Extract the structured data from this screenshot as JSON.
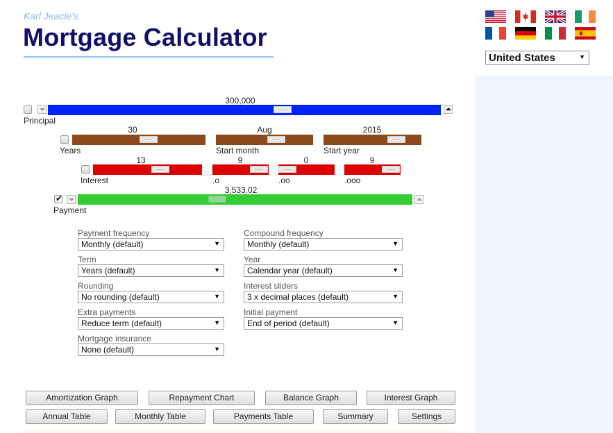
{
  "header": {
    "subtitle": "Karl Jeacle's",
    "title": "Mortgage Calculator"
  },
  "flags": [
    {
      "name": "us-flag-icon",
      "country": "United States"
    },
    {
      "name": "canada-flag-icon",
      "country": "Canada"
    },
    {
      "name": "uk-flag-icon",
      "country": "United Kingdom"
    },
    {
      "name": "ireland-flag-icon",
      "country": "Ireland"
    },
    {
      "name": "france-flag-icon",
      "country": "France"
    },
    {
      "name": "germany-flag-icon",
      "country": "Germany"
    },
    {
      "name": "italy-flag-icon",
      "country": "Italy"
    },
    {
      "name": "spain-flag-icon",
      "country": "Spain"
    }
  ],
  "country_select": {
    "value": "United States"
  },
  "sliders": {
    "principal": {
      "label": "Principal",
      "value": "300,000",
      "color": "#0022ff",
      "checked": false
    },
    "years": {
      "label": "Years",
      "value": "30",
      "color": "#8b4a1b"
    },
    "start_month": {
      "label": "Start month",
      "value": "Aug",
      "color": "#8b4a1b"
    },
    "start_year": {
      "label": "Start year",
      "value": "2015",
      "color": "#8b4a1b"
    },
    "interest": {
      "label": "Interest",
      "value": "13",
      "color": "#dd0000"
    },
    "interest_d1": {
      "label": ".o",
      "value": "9",
      "color": "#dd0000"
    },
    "interest_d2": {
      "label": ".oo",
      "value": "0",
      "color": "#dd0000"
    },
    "interest_d3": {
      "label": ".ooo",
      "value": "9",
      "color": "#dd0000"
    },
    "payment": {
      "label": "Payment",
      "value": "3,533.02",
      "color": "#33cc33",
      "checked": true
    }
  },
  "options": {
    "payment_frequency": {
      "label": "Payment frequency",
      "value": "Monthly (default)"
    },
    "compound_frequency": {
      "label": "Compound frequency",
      "value": "Monthly (default)"
    },
    "term": {
      "label": "Term",
      "value": "Years (default)"
    },
    "year": {
      "label": "Year",
      "value": "Calendar year (default)"
    },
    "rounding": {
      "label": "Rounding",
      "value": "No rounding (default)"
    },
    "interest_sliders": {
      "label": "Interest sliders",
      "value": "3 x decimal places (default)"
    },
    "extra_payments": {
      "label": "Extra payments",
      "value": "Reduce term (default)"
    },
    "initial_payment": {
      "label": "Initial payment",
      "value": "End of period (default)"
    },
    "mortgage_insurance": {
      "label": "Mortgage insurance",
      "value": "None (default)"
    }
  },
  "buttons": {
    "amortization_graph": "Amortization Graph",
    "repayment_chart": "Repayment Chart",
    "balance_graph": "Balance Graph",
    "interest_graph": "Interest Graph",
    "annual_table": "Annual Table",
    "monthly_table": "Monthly Table",
    "payments_table": "Payments Table",
    "summary": "Summary",
    "settings": "Settings"
  },
  "colors": {
    "title": "#10106a",
    "subtitle": "#8ab8e6",
    "title_rule": "#8bc3f0",
    "side_panel": "#eef5fd"
  }
}
